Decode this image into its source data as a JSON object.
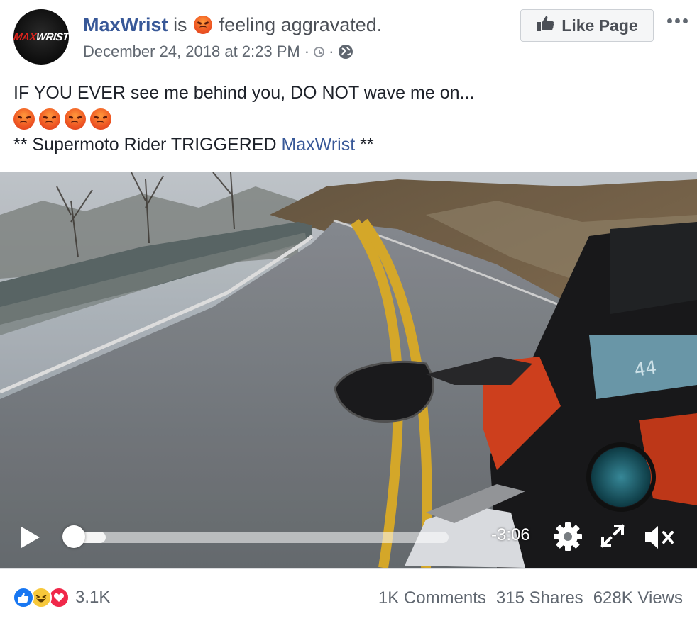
{
  "post": {
    "page_name": "MaxWrist",
    "avatar_logo": {
      "part1": "MAX",
      "part2": "WRIST"
    },
    "is_word": "is",
    "feeling_text": "feeling aggravated.",
    "date": "December 24, 2018 at 2:23 PM",
    "meta_separator": "·",
    "like_page_label": "Like Page",
    "text_line1": "IF YOU EVER see me behind you, DO NOT wave me on...",
    "text_line3_prefix": "** Supermoto Rider TRIGGERED ",
    "text_line3_tag": "MaxWrist",
    "text_line3_suffix": " **",
    "emoji_count": 4
  },
  "video": {
    "time_remaining": "-3:06",
    "progress_fraction": 0.0,
    "buffered_fraction": 0.09,
    "dash_speed": "44"
  },
  "footer": {
    "reaction_count": "3.1K",
    "comments": "1K Comments",
    "shares": "315 Shares",
    "views": "628K Views"
  },
  "icons": {
    "play": "play-icon",
    "settings": "gear-icon",
    "fullscreen": "expand-icon",
    "mute": "speaker-muted-icon",
    "audience": "globe-icon",
    "clock": "clock-icon",
    "like": "thumbs-up-icon"
  },
  "colors": {
    "link": "#385898",
    "meta_text": "#606770",
    "like_reaction": "#1877f2",
    "haha_reaction": "#f7c83b",
    "love_reaction": "#f0284a",
    "angry_emoji": "#f05a24"
  }
}
